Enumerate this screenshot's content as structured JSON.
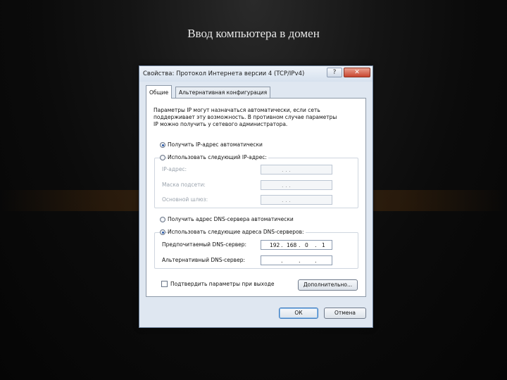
{
  "slide": {
    "title": "Ввод компьютера в домен"
  },
  "dialog": {
    "title": "Свойства: Протокол Интернета версии 4 (TCP/IPv4)",
    "help_label": "?",
    "close_label": "✕",
    "tabs": [
      {
        "label": "Общие",
        "active": true
      },
      {
        "label": "Альтернативная конфигурация",
        "active": false
      }
    ],
    "intro_lines": [
      "Параметры IP могут назначаться автоматически, если сеть",
      "поддерживает эту возможность. В противном случае параметры",
      "IP можно получить у сетевого администратора."
    ],
    "ip_auto_label": "Получить IP-адрес автоматически",
    "ip_manual_label": "Использовать следующий IP-адрес:",
    "ip_fields": [
      {
        "label": "IP-адрес:",
        "value": ". . ."
      },
      {
        "label": "Маска подсети:",
        "value": ". . ."
      },
      {
        "label": "Основной шлюз:",
        "value": ". . ."
      }
    ],
    "dns_auto_label": "Получить адрес DNS-сервера автоматически",
    "dns_manual_label": "Использовать следующие адреса DNS-серверов:",
    "preferred_dns": {
      "label": "Предпочитаемый DNS-сервер:",
      "octets": [
        "192",
        "168",
        "0",
        "1"
      ]
    },
    "alternate_dns": {
      "label": "Альтернативный DNS-сервер:",
      "octets": [
        "",
        "",
        "",
        ""
      ]
    },
    "confirm_checkbox_label": "Подтвердить параметры при выходе",
    "advanced_button": "Дополнительно...",
    "ok_button": "ОК",
    "cancel_button": "Отмена"
  }
}
